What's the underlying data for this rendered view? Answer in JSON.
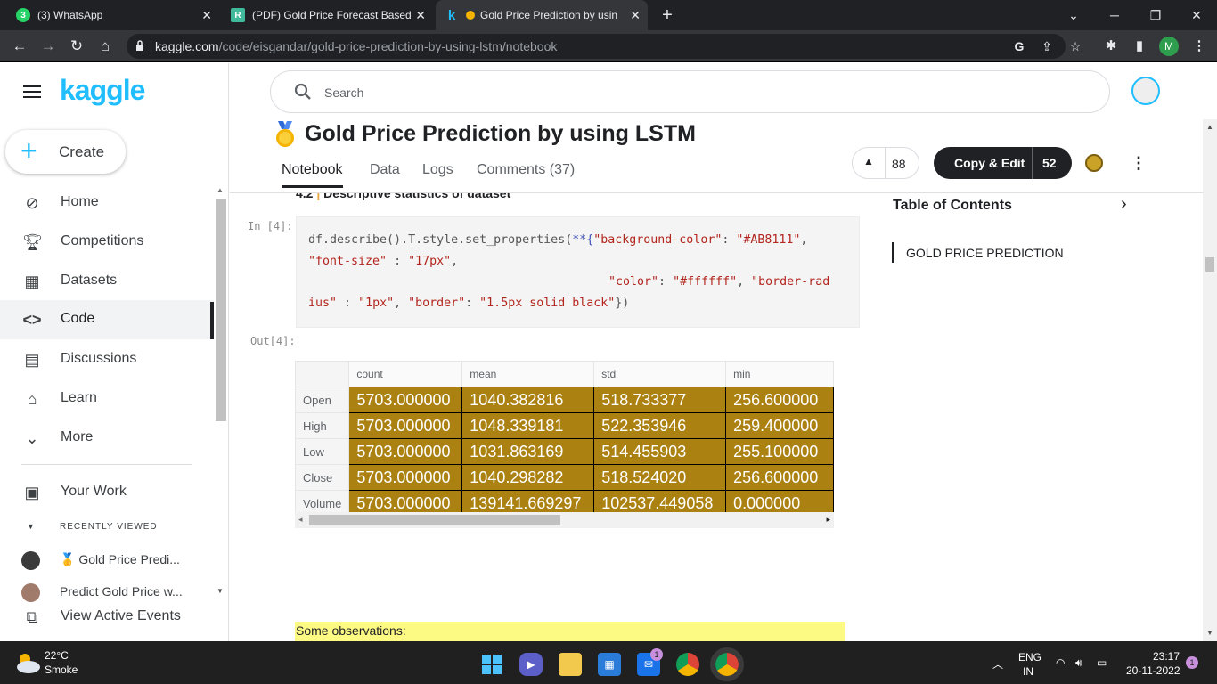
{
  "browser": {
    "tabs": [
      {
        "title": "(3) WhatsApp"
      },
      {
        "title": "(PDF) Gold Price Forecast Based o"
      },
      {
        "title": "Gold Price Prediction by usin"
      }
    ],
    "url_domain": "kaggle.com",
    "url_path": "/code/eisgandar/gold-price-prediction-by-using-lstm/notebook",
    "profile_initial": "M"
  },
  "sidebar": {
    "logo": "kaggle",
    "create_label": "Create",
    "items": [
      {
        "label": "Home",
        "icon": "compass-icon"
      },
      {
        "label": "Competitions",
        "icon": "trophy-icon"
      },
      {
        "label": "Datasets",
        "icon": "table-icon"
      },
      {
        "label": "Code",
        "icon": "code-icon"
      },
      {
        "label": "Discussions",
        "icon": "chat-icon"
      },
      {
        "label": "Learn",
        "icon": "school-icon"
      },
      {
        "label": "More",
        "icon": "chevron-down-icon"
      }
    ],
    "your_work": "Your Work",
    "recently_viewed": "RECENTLY VIEWED",
    "recent_items": [
      "🥇 Gold Price Predi...",
      "Predict Gold Price w..."
    ],
    "view_active_events": "View Active Events"
  },
  "header": {
    "search_placeholder": "Search"
  },
  "notebook": {
    "title": "Gold Price Prediction by using LSTM",
    "tabs": [
      "Notebook",
      "Data",
      "Logs",
      "Comments (37)"
    ],
    "upvotes": "88",
    "copy_edit_label": "Copy & Edit",
    "copy_edit_count": "52"
  },
  "content": {
    "section_heading_num": "4.2",
    "section_heading_text": "Descriptive statistics of dataset",
    "in_label": "In [4]:",
    "out_label": "Out[4]:",
    "code": {
      "l1_a": "df.describe().T.style.set_properties(",
      "l1_b": "**{",
      "l1_c": "\"background-color\"",
      "l1_d": ": ",
      "l1_e": "\"#AB8111\"",
      "l1_f": ",",
      "l2_a": "\"font-size\"",
      "l2_b": " : ",
      "l2_c": "\"17px\"",
      "l2_d": ",",
      "l3_a": "\"color\"",
      "l3_b": ": ",
      "l3_c": "\"#ffffff\"",
      "l3_d": ", ",
      "l3_e": "\"border-rad",
      "l4_a": "ius\"",
      "l4_b": " : ",
      "l4_c": "\"1px\"",
      "l4_d": ", ",
      "l4_e": "\"border\"",
      "l4_f": ": ",
      "l4_g": "\"1.5px solid black\"",
      "l4_h": "})"
    },
    "table": {
      "columns": [
        "count",
        "mean",
        "std",
        "min"
      ],
      "rows": [
        {
          "label": "Open",
          "values": [
            "5703.000000",
            "1040.382816",
            "518.733377",
            "256.600000"
          ]
        },
        {
          "label": "High",
          "values": [
            "5703.000000",
            "1048.339181",
            "522.353946",
            "259.400000"
          ]
        },
        {
          "label": "Low",
          "values": [
            "5703.000000",
            "1031.863169",
            "514.455903",
            "255.100000"
          ]
        },
        {
          "label": "Close",
          "values": [
            "5703.000000",
            "1040.298282",
            "518.524020",
            "256.600000"
          ]
        },
        {
          "label": "Volume",
          "values": [
            "5703.000000",
            "139141.669297",
            "102537.449058",
            "0.000000"
          ]
        }
      ]
    },
    "observations": "Some observations:"
  },
  "toc": {
    "title": "Table of Contents",
    "items": [
      "GOLD PRICE PREDICTION"
    ]
  },
  "taskbar": {
    "temperature": "22°C",
    "weather": "Smoke",
    "lang1": "ENG",
    "lang2": "IN",
    "time": "23:17",
    "date": "20-11-2022",
    "mail_badge": "1",
    "notif_badge": "1"
  },
  "colors": {
    "kaggle_blue": "#20beff",
    "table_bg": "#AB8111",
    "observation_bg": "#fdfa84"
  }
}
